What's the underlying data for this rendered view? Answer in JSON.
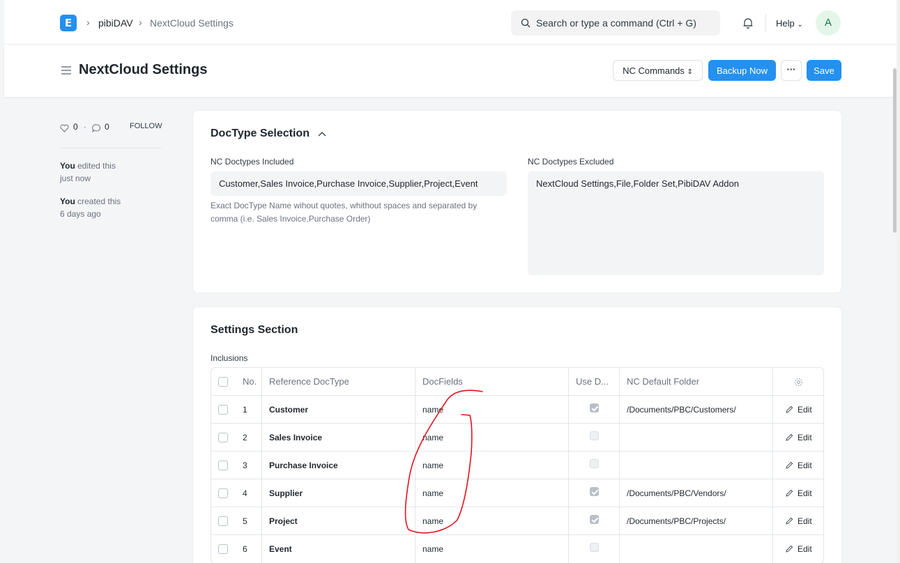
{
  "navbar": {
    "logo_letter": "E",
    "breadcrumbs": [
      "pibiDAV",
      "NextCloud Settings"
    ],
    "search_placeholder": "Search or type a command (Ctrl + G)",
    "help_label": "Help",
    "avatar_initial": "A"
  },
  "page": {
    "title": "NextCloud Settings",
    "nc_commands_label": "NC Commands",
    "backup_label": "Backup Now",
    "more_label": "···",
    "save_label": "Save"
  },
  "sidebar": {
    "likes": "0",
    "comments": "0",
    "follow_label": "FOLLOW",
    "timeline": [
      {
        "who": "You",
        "action": "edited this",
        "when": "just now"
      },
      {
        "who": "You",
        "action": "created this",
        "when": "6 days ago"
      }
    ]
  },
  "doctype_section": {
    "title": "DocType Selection",
    "included_label": "NC Doctypes Included",
    "included_value": "Customer,Sales Invoice,Purchase Invoice,Supplier,Project,Event",
    "included_help_1": "Exact DocType Name wihout quotes, whithout spaces and separated by",
    "included_help_2": "comma (i.e. Sales Invoice,Purchase Order)",
    "excluded_label": "NC Doctypes Excluded",
    "excluded_value": "NextCloud Settings,File,Folder Set,PibiDAV Addon"
  },
  "settings_section": {
    "title": "Settings Section",
    "table_label": "Inclusions",
    "columns": [
      "No.",
      "Reference DocType",
      "DocFields",
      "Use D...",
      "NC Default Folder"
    ],
    "edit_label": "Edit",
    "rows": [
      {
        "no": "1",
        "ref": "Customer",
        "fields": "name",
        "use": true,
        "folder": "/Documents/PBC/Customers/"
      },
      {
        "no": "2",
        "ref": "Sales Invoice",
        "fields": "name",
        "use": false,
        "folder": ""
      },
      {
        "no": "3",
        "ref": "Purchase Invoice",
        "fields": "name",
        "use": false,
        "folder": ""
      },
      {
        "no": "4",
        "ref": "Supplier",
        "fields": "name",
        "use": true,
        "folder": "/Documents/PBC/Vendors/"
      },
      {
        "no": "5",
        "ref": "Project",
        "fields": "name",
        "use": true,
        "folder": "/Documents/PBC/Projects/"
      },
      {
        "no": "6",
        "ref": "Event",
        "fields": "name",
        "use": false,
        "folder": ""
      }
    ]
  },
  "colors": {
    "primary": "#2490ef",
    "annotation": "#e0141e"
  }
}
